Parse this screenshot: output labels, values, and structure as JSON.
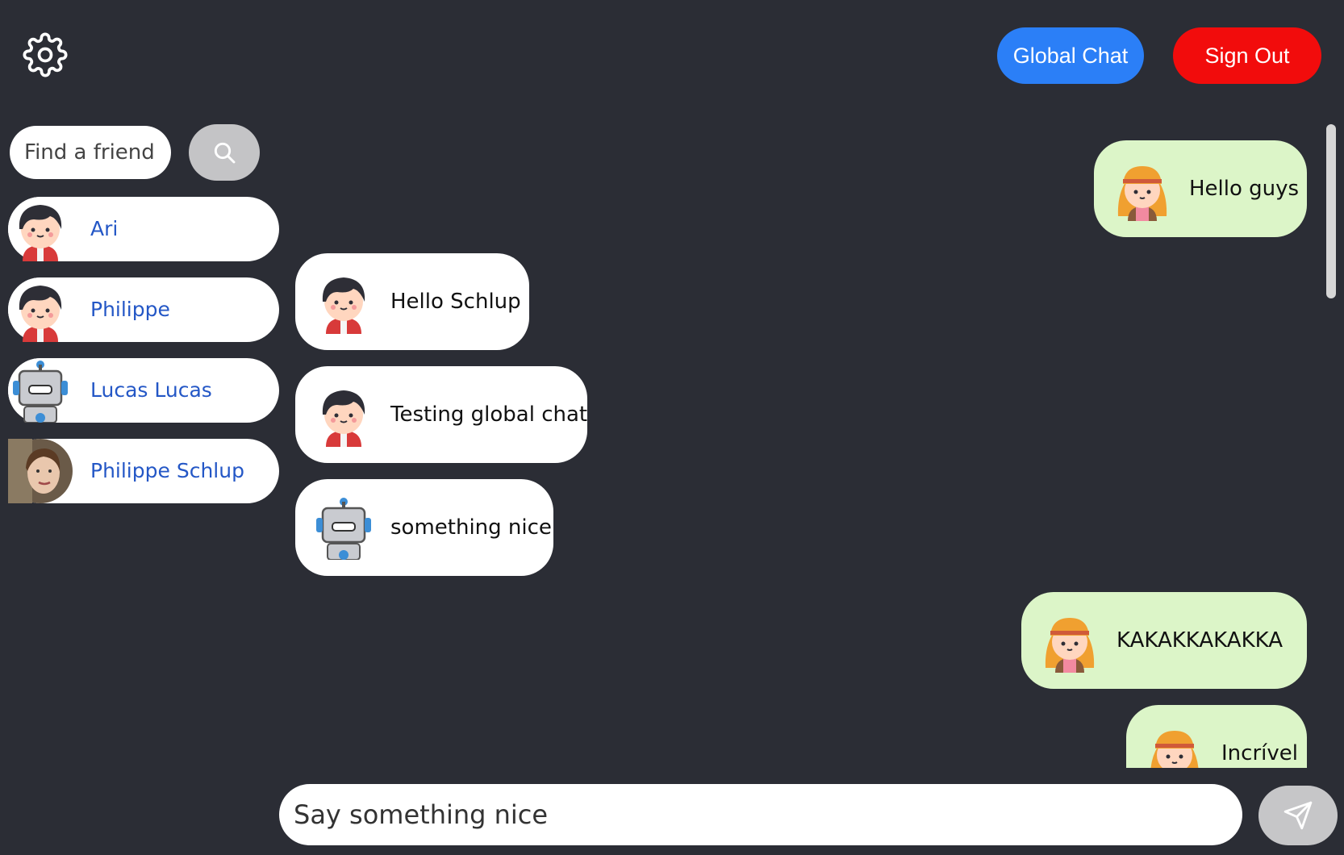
{
  "header": {
    "settings_icon": "gear-icon",
    "global_chat_label": "Global Chat",
    "sign_out_label": "Sign Out",
    "global_chat_color": "#2b7ff7",
    "sign_out_color": "#f20c0c"
  },
  "search": {
    "placeholder": "Find a friend",
    "button_icon": "search-icon"
  },
  "friends": [
    {
      "name": "Ari",
      "avatar": "boy-avatar"
    },
    {
      "name": "Philippe",
      "avatar": "boy-avatar"
    },
    {
      "name": "Lucas Lucas",
      "avatar": "robot-avatar"
    },
    {
      "name": "Philippe Schlup",
      "avatar": "photo-avatar"
    }
  ],
  "messages": [
    {
      "text": "Hello guys",
      "mine": true,
      "avatar": "girl-avatar"
    },
    {
      "text": "Hello Schlup",
      "mine": false,
      "avatar": "boy-avatar"
    },
    {
      "text": "Testing global chat",
      "mine": false,
      "avatar": "boy-avatar"
    },
    {
      "text": "something nice",
      "mine": false,
      "avatar": "robot-avatar"
    },
    {
      "text": "KAKAKKAKAKKA",
      "mine": true,
      "avatar": "girl-avatar"
    },
    {
      "text": "Incrível",
      "mine": true,
      "avatar": "girl-avatar"
    }
  ],
  "composer": {
    "placeholder": "Say something nice",
    "send_icon": "send-icon"
  },
  "colors": {
    "background": "#2b2d35",
    "my_bubble": "#dcf5c8",
    "other_bubble": "#ffffff",
    "friend_name": "#2457c6"
  }
}
